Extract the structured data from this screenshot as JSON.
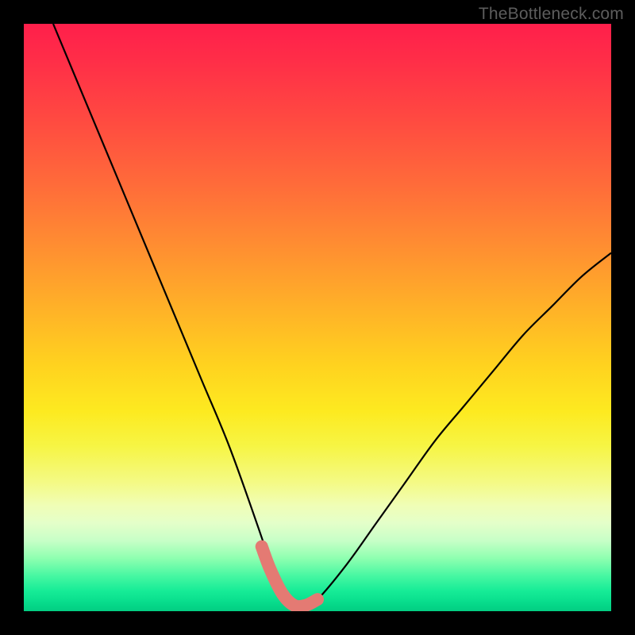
{
  "watermark": "TheBottleneck.com",
  "chart_data": {
    "type": "line",
    "title": "",
    "xlabel": "",
    "ylabel": "",
    "xlim": [
      0,
      100
    ],
    "ylim": [
      0,
      100
    ],
    "series": [
      {
        "name": "bottleneck-curve",
        "x": [
          5,
          10,
          15,
          20,
          25,
          30,
          35,
          40,
          42,
          44,
          46,
          48,
          50,
          55,
          60,
          65,
          70,
          75,
          80,
          85,
          90,
          95,
          100
        ],
        "y": [
          100,
          88,
          76,
          64,
          52,
          40,
          28,
          14,
          8,
          3,
          1,
          1,
          2,
          8,
          15,
          22,
          29,
          35,
          41,
          47,
          52,
          57,
          61
        ]
      },
      {
        "name": "highlight-band",
        "x": [
          40.5,
          42,
          44,
          46,
          48,
          50
        ],
        "y": [
          11,
          7,
          3,
          1,
          1,
          2
        ]
      }
    ],
    "annotations": [],
    "legend": null,
    "grid": false,
    "background": "rainbow-gradient-red-to-green-vertical"
  }
}
